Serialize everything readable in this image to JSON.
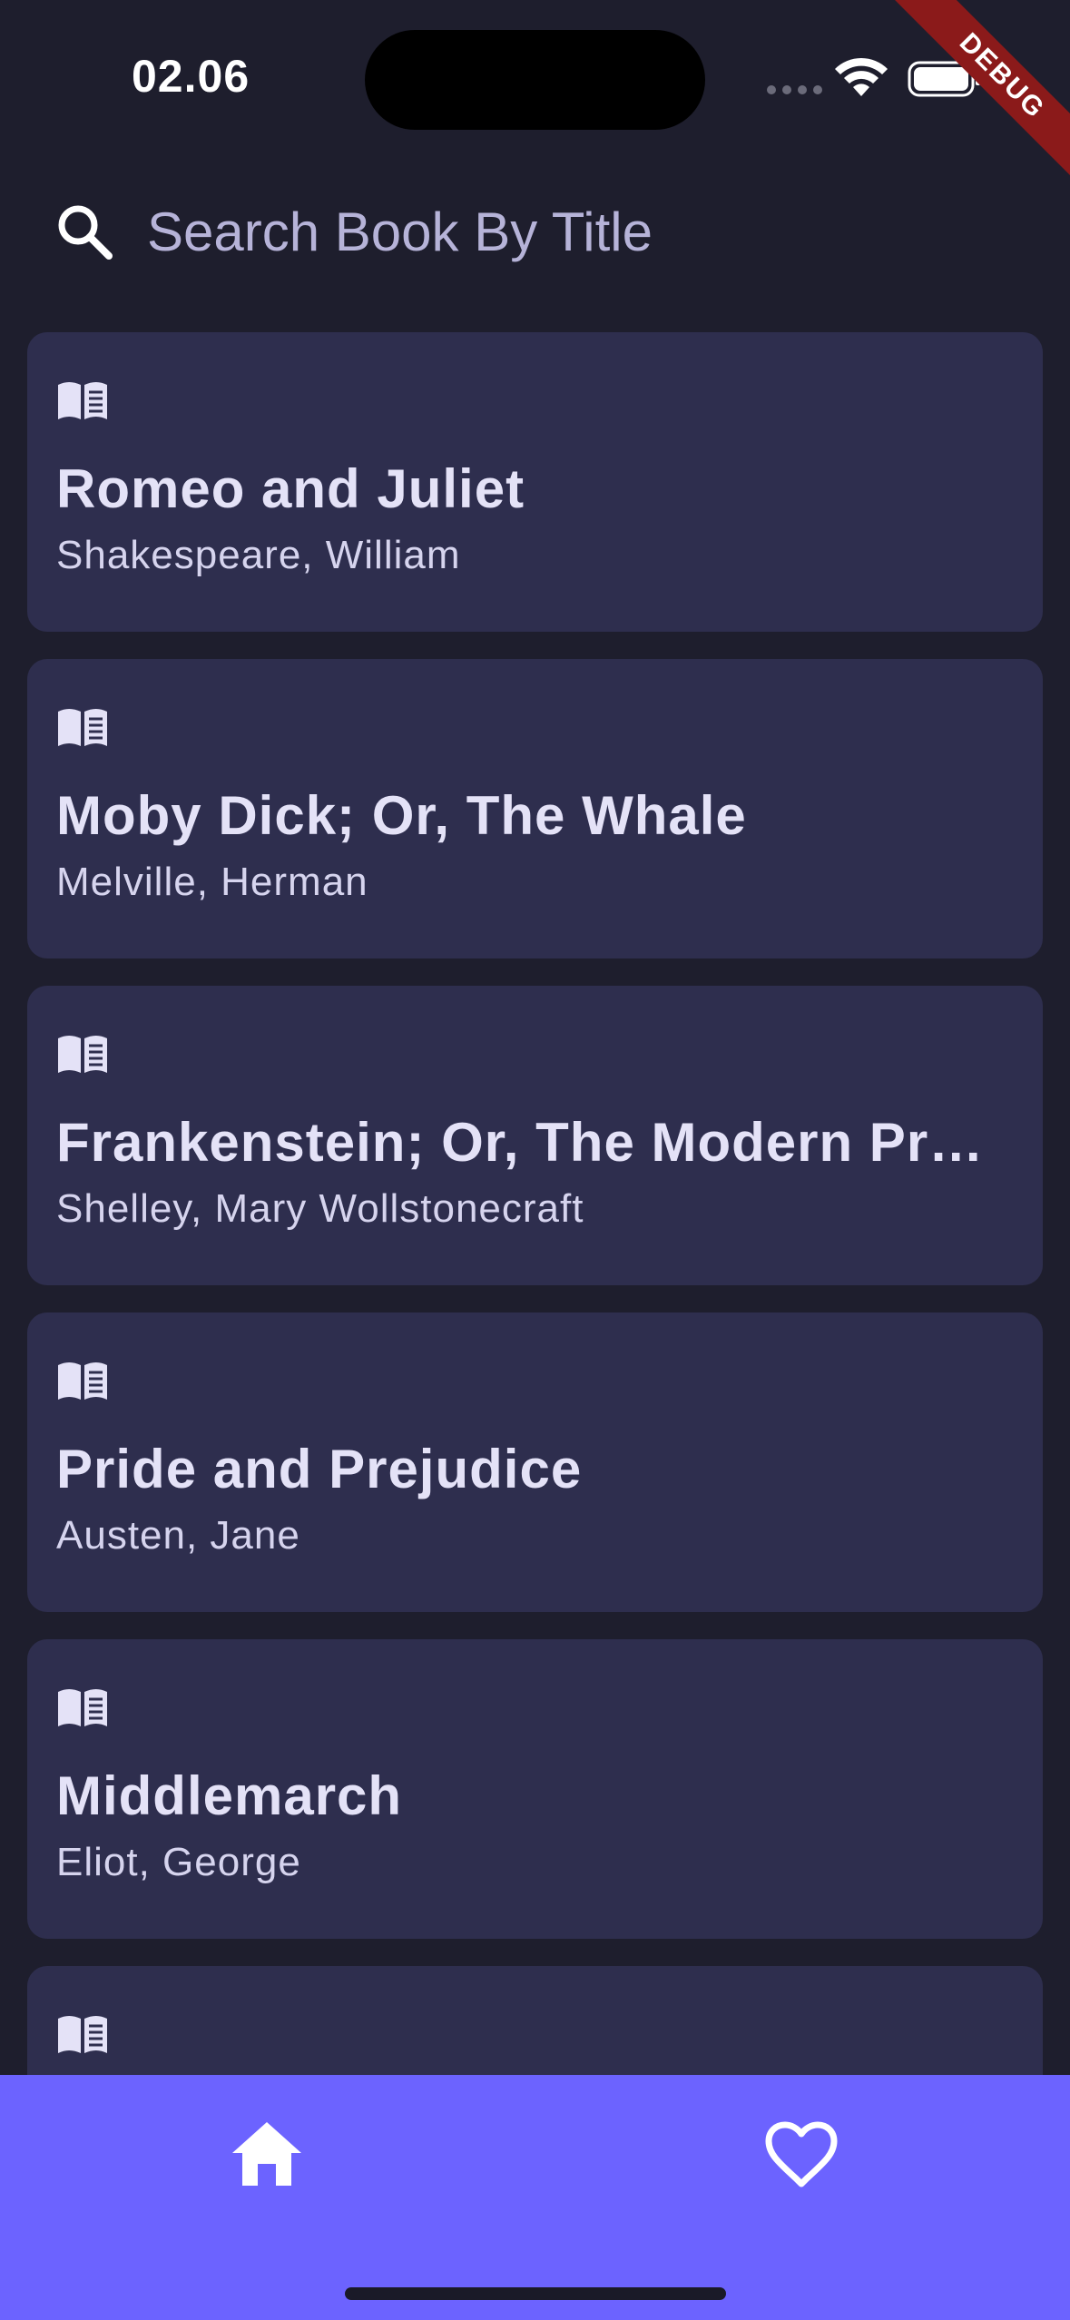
{
  "status_bar": {
    "time": "02.06"
  },
  "debug_banner": {
    "label": "DEBUG",
    "color": "#8b1a1a"
  },
  "search": {
    "placeholder": "Search Book By Title",
    "value": "",
    "icon": "search-icon"
  },
  "books": [
    {
      "icon": "book-icon",
      "title": "Romeo and Juliet",
      "author": "Shakespeare, William"
    },
    {
      "icon": "book-icon",
      "title": "Moby Dick; Or, The Whale",
      "author": "Melville, Herman"
    },
    {
      "icon": "book-icon",
      "title": "Frankenstein; Or, The Modern Prometheus",
      "author": "Shelley, Mary Wollstonecraft"
    },
    {
      "icon": "book-icon",
      "title": "Pride and Prejudice",
      "author": "Austen, Jane"
    },
    {
      "icon": "book-icon",
      "title": "Middlemarch",
      "author": "Eliot, George"
    },
    {
      "icon": "book-icon",
      "title": "",
      "author": ""
    }
  ],
  "bottom_nav": {
    "items": [
      {
        "icon": "home-icon",
        "active": true
      },
      {
        "icon": "heart-icon",
        "active": false
      }
    ]
  },
  "colors": {
    "background": "#1e1e2d",
    "card": "#2e2e4e",
    "accent": "#6c63ff",
    "text": "#e4e2f7"
  }
}
